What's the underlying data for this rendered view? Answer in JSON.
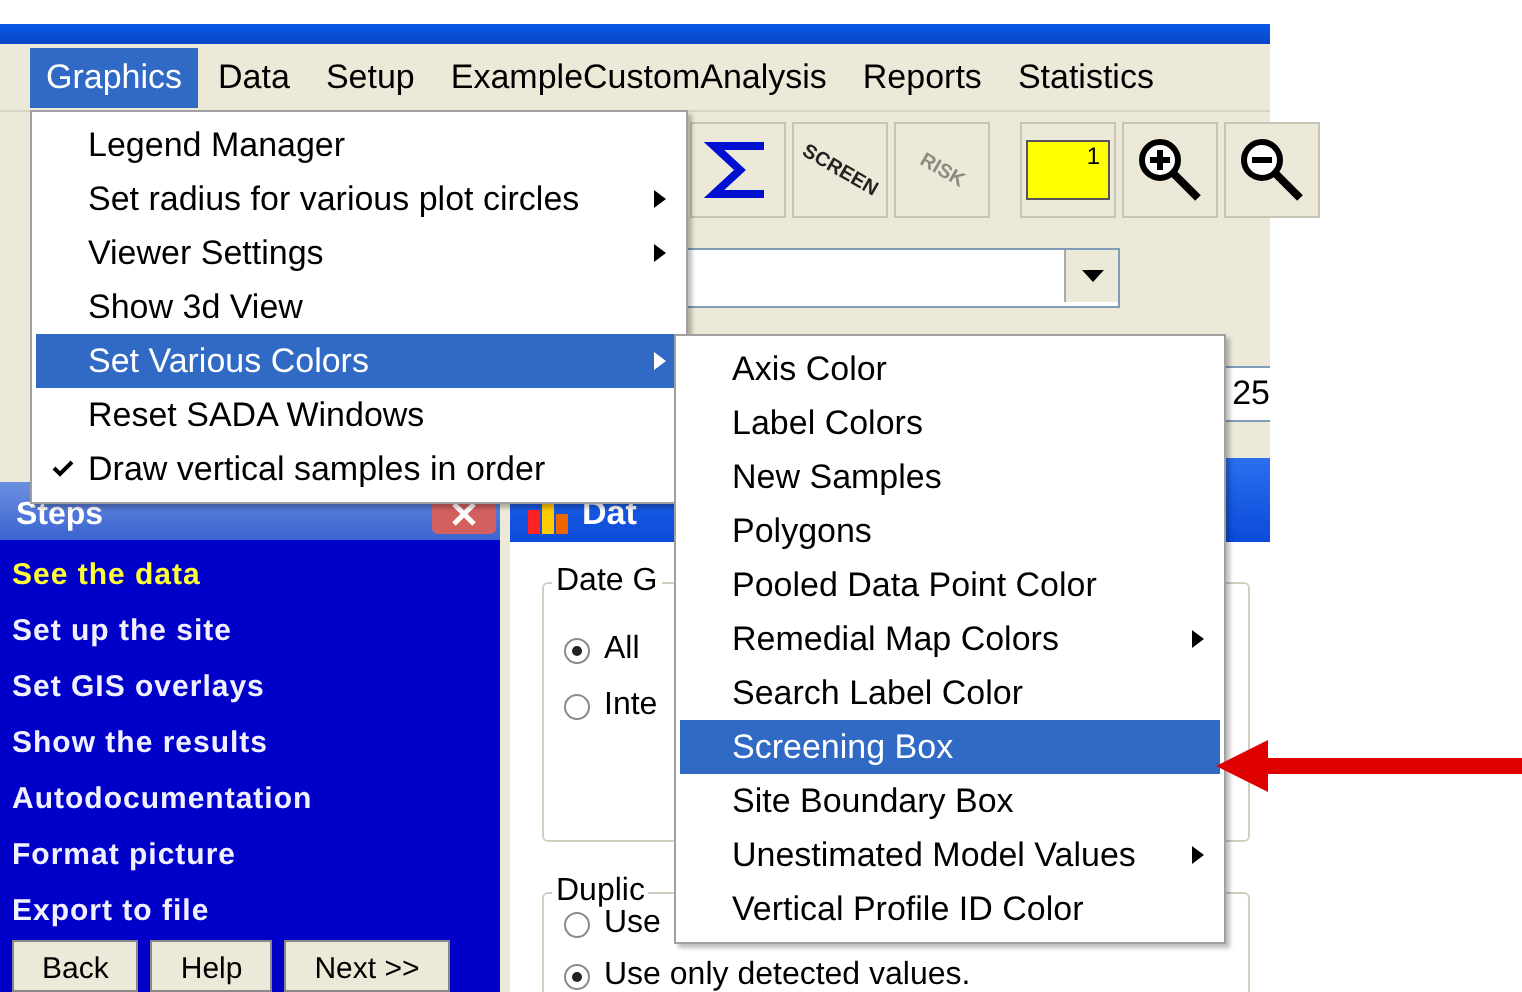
{
  "menubar": [
    {
      "label": "Graphics",
      "selected": true
    },
    {
      "label": "Data",
      "selected": false
    },
    {
      "label": "Setup",
      "selected": false
    },
    {
      "label": "ExampleCustomAnalysis",
      "selected": false
    },
    {
      "label": "Reports",
      "selected": false
    },
    {
      "label": "Statistics",
      "selected": false
    }
  ],
  "toolbar": [
    {
      "kind": "sigma"
    },
    {
      "kind": "screen",
      "label": "SCREEN"
    },
    {
      "kind": "risk",
      "label": "RISK",
      "disabled": true
    },
    {
      "kind": "ruler",
      "label": "1"
    },
    {
      "kind": "zoom-in"
    },
    {
      "kind": "zoom-out"
    }
  ],
  "value_field": {
    "value": "25"
  },
  "graphics_menu": [
    {
      "label": "Legend Manager",
      "submenu": false,
      "checked": false,
      "selected": false
    },
    {
      "label": "Set radius for various plot circles",
      "submenu": true,
      "checked": false,
      "selected": false
    },
    {
      "label": "Viewer Settings",
      "submenu": true,
      "checked": false,
      "selected": false
    },
    {
      "label": "Show 3d View",
      "submenu": false,
      "checked": false,
      "selected": false
    },
    {
      "label": "Set Various Colors",
      "submenu": true,
      "checked": false,
      "selected": true
    },
    {
      "label": "Reset SADA Windows",
      "submenu": false,
      "checked": false,
      "selected": false
    },
    {
      "label": "Draw vertical samples in order",
      "submenu": false,
      "checked": true,
      "selected": false
    }
  ],
  "colors_submenu": [
    {
      "label": "Axis Color",
      "submenu": false,
      "selected": false
    },
    {
      "label": "Label Colors",
      "submenu": false,
      "selected": false
    },
    {
      "label": "New Samples",
      "submenu": false,
      "selected": false
    },
    {
      "label": "Polygons",
      "submenu": false,
      "selected": false
    },
    {
      "label": "Pooled Data Point Color",
      "submenu": false,
      "selected": false
    },
    {
      "label": "Remedial Map Colors",
      "submenu": true,
      "selected": false
    },
    {
      "label": "Search Label Color",
      "submenu": false,
      "selected": false
    },
    {
      "label": "Screening Box",
      "submenu": false,
      "selected": true
    },
    {
      "label": "Site Boundary Box",
      "submenu": false,
      "selected": false
    },
    {
      "label": "Unestimated Model Values",
      "submenu": true,
      "selected": false
    },
    {
      "label": "Vertical Profile ID Color",
      "submenu": false,
      "selected": false
    }
  ],
  "steps_panel": {
    "title": "Steps",
    "items": [
      {
        "label": "See the data",
        "selected": true
      },
      {
        "label": "Set up the site",
        "selected": false
      },
      {
        "label": "Set GIS overlays",
        "selected": false
      },
      {
        "label": "Show the results",
        "selected": false
      },
      {
        "label": "Autodocumentation",
        "selected": false
      },
      {
        "label": "Format picture",
        "selected": false
      },
      {
        "label": "Export to file",
        "selected": false
      }
    ],
    "buttons": [
      "Back",
      "Help",
      "Next >>"
    ]
  },
  "dialog": {
    "title": "Dat",
    "groups": [
      {
        "title": "Date G",
        "options": [
          {
            "label": "All",
            "selected": true
          },
          {
            "label": "Inte",
            "selected": false
          }
        ]
      },
      {
        "title": "Duplic",
        "options": [
          {
            "label": "Use",
            "selected": false
          },
          {
            "label": "Use only detected values.",
            "selected": true
          }
        ]
      }
    ]
  }
}
